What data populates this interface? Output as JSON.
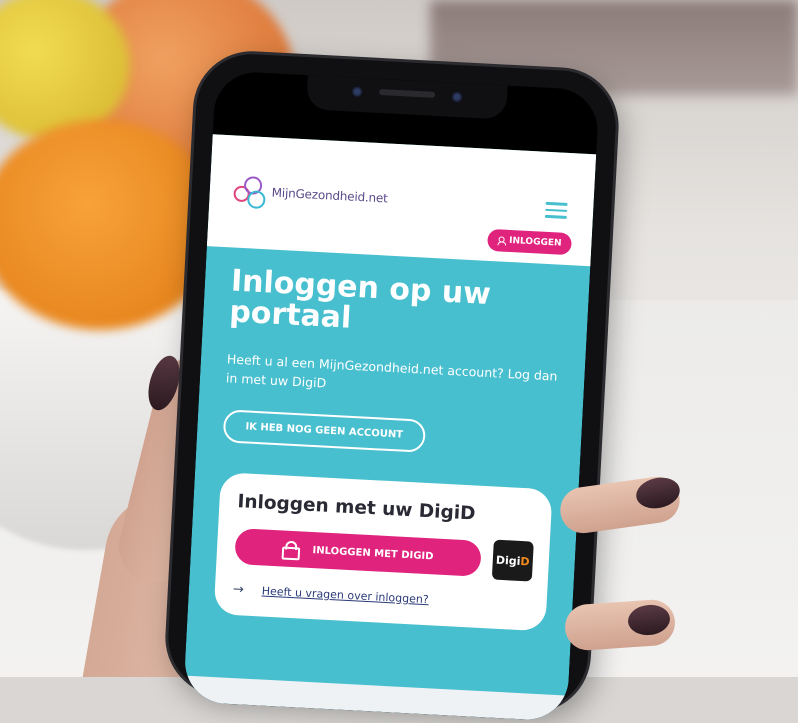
{
  "site": {
    "logo_text": "MijnGezondheid.net"
  },
  "header": {
    "menu_icon": "hamburger-icon",
    "login_label": "INLOGGEN",
    "login_icon": "person-icon"
  },
  "hero": {
    "title_line1": "Inloggen op uw",
    "title_line2": "portaal",
    "description": "Heeft u al een MijnGezondheid.net account? Log dan in met uw DigiD",
    "no_account_label": "IK HEB NOG GEEN ACCOUNT"
  },
  "digid_card": {
    "title": "Inloggen met uw DigiD",
    "button_label": "INLOGGEN MET DIGID",
    "button_icon": "lock-icon",
    "logo_text_a": "Digi",
    "logo_text_b": "D",
    "help_arrow": "→",
    "help_link": "Heeft u vragen over inloggen?"
  },
  "colors": {
    "brand_teal": "#48bfcf",
    "brand_pink": "#e0237d",
    "link_navy": "#2b3a78"
  }
}
